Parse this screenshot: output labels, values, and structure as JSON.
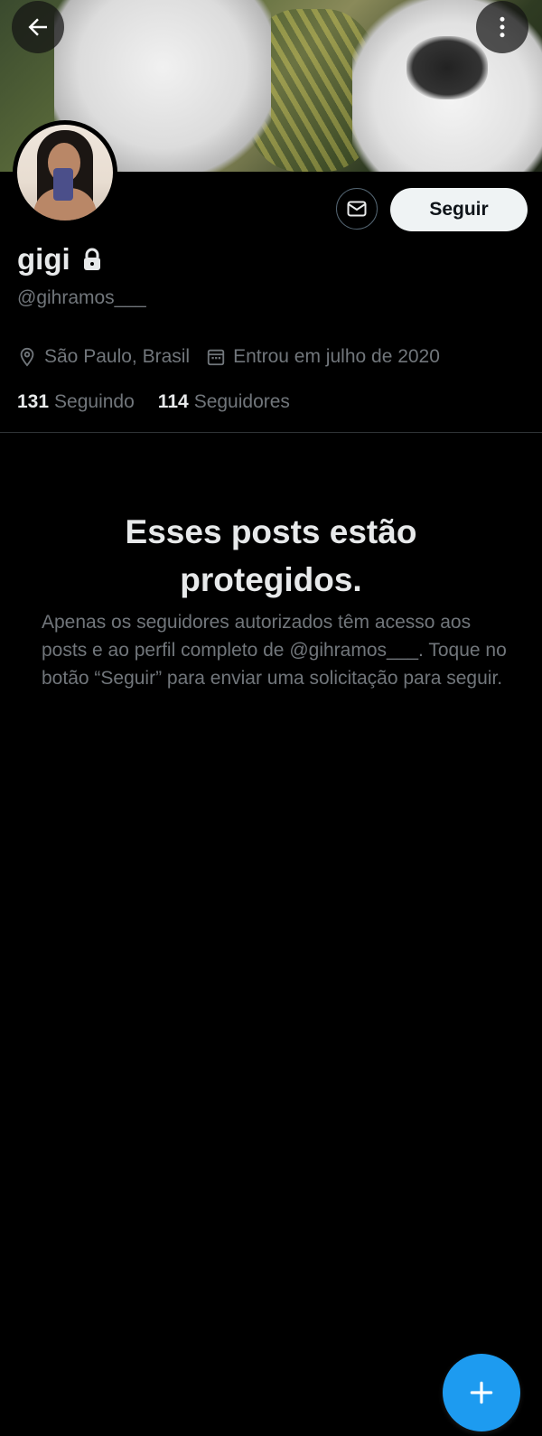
{
  "profile": {
    "name": "gigi",
    "handle": "@gihramos___",
    "location": "São Paulo, Brasil",
    "joined": "Entrou em julho de 2020",
    "following_count": "131",
    "following_label": "Seguindo",
    "followers_count": "114",
    "followers_label": "Seguidores"
  },
  "actions": {
    "follow_label": "Seguir"
  },
  "protected": {
    "title": "Esses posts estão protegidos.",
    "message": "Apenas os seguidores autorizados têm acesso aos posts e ao perfil completo de @gihramos___. Toque no botão “Seguir” para enviar uma solicitação para seguir."
  },
  "icons": {
    "back": "back-arrow-icon",
    "more": "more-vertical-icon",
    "message": "mail-icon",
    "lock": "lock-icon",
    "location": "location-pin-icon",
    "calendar": "calendar-icon",
    "compose": "plus-icon"
  },
  "colors": {
    "accent": "#1d9bf0",
    "background": "#000000",
    "secondary_text": "#71767b",
    "primary_text": "#e7e9ea"
  }
}
